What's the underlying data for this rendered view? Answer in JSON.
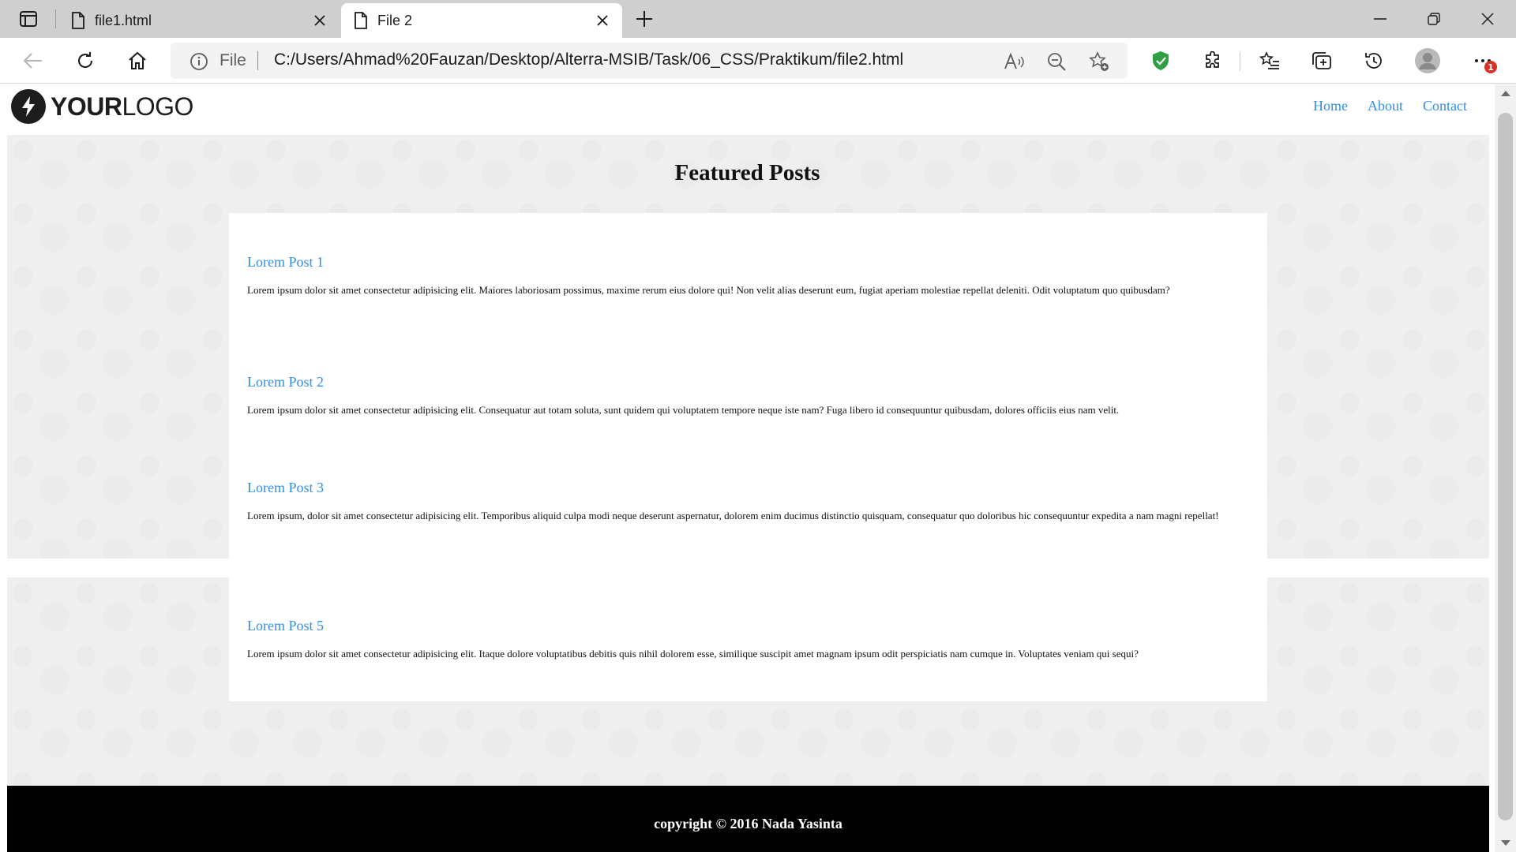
{
  "browser": {
    "tabs": [
      {
        "title": "file1.html",
        "active": false
      },
      {
        "title": "File 2",
        "active": true
      }
    ],
    "address": {
      "scheme_label": "File",
      "url": "C:/Users/Ahmad%20Fauzan/Desktop/Alterra-MSIB/Task/06_CSS/Praktikum/file2.html"
    },
    "notification_badge": "1",
    "icons": [
      "sidebar-icon",
      "page-icon",
      "close-icon",
      "plus-icon",
      "minimize-icon",
      "restore-icon",
      "back-icon",
      "refresh-icon",
      "home-icon",
      "info-icon",
      "read-aloud-icon",
      "zoom-out-icon",
      "add-favorite-icon",
      "shield-icon",
      "extensions-icon",
      "favorites-icon",
      "collections-icon",
      "history-icon",
      "profile-icon",
      "more-icon"
    ],
    "colors": {
      "accent_shield": "#2ea043",
      "badge": "#d93025"
    }
  },
  "site": {
    "logo": {
      "bold": "YOUR",
      "regular": "LOGO"
    },
    "nav": [
      "Home",
      "About",
      "Contact"
    ],
    "featured_title": "Featured Posts",
    "posts": [
      {
        "title": "Lorem Post 1",
        "body": "Lorem ipsum dolor sit amet consectetur adipisicing elit. Maiores laboriosam possimus, maxime rerum eius dolore qui! Non velit alias deserunt eum, fugiat aperiam molestiae repellat deleniti. Odit voluptatum quo quibusdam?"
      },
      {
        "title": "Lorem Post 2",
        "body": "Lorem ipsum dolor sit amet consectetur adipisicing elit. Consequatur aut totam soluta, sunt quidem qui voluptatem tempore neque iste nam? Fuga libero id consequuntur quibusdam, dolores officiis eius nam velit."
      },
      {
        "title": "Lorem Post 3",
        "body": "Lorem ipsum, dolor sit amet consectetur adipisicing elit. Temporibus aliquid culpa modi neque deserunt aspernatur, dolorem enim ducimus distinctio quisquam, consequatur quo doloribus hic consequuntur expedita a nam magni repellat!"
      },
      {
        "title": "Lorem Post 5",
        "body": "Lorem ipsum dolor sit amet consectetur adipisicing elit. Itaque dolore voluptatibus debitis quis nihil dolorem esse, similique suscipit amet magnam ipsum odit perspiciatis nam cumque in. Voluptates veniam qui sequi?"
      }
    ],
    "footer": "copyright © 2016 Nada Yasinta",
    "colors": {
      "link": "#2f8fea",
      "footer_bg": "#000000",
      "section_bg": "#efefef"
    }
  }
}
